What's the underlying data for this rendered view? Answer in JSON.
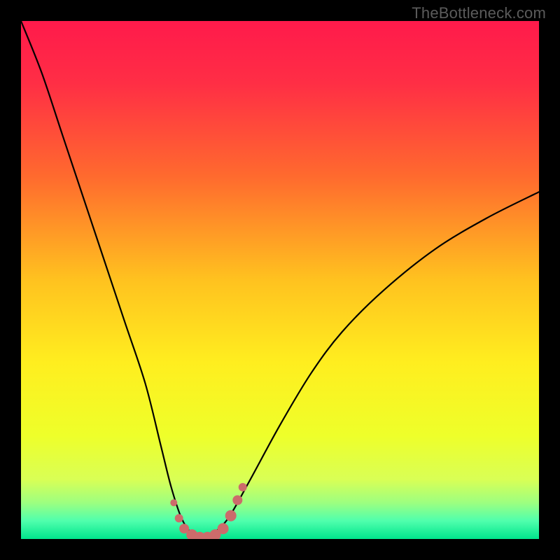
{
  "watermark": "TheBottleneck.com",
  "colors": {
    "frame": "#000000",
    "gradient_stops": [
      {
        "offset": 0.0,
        "color": "#ff1a4b"
      },
      {
        "offset": 0.12,
        "color": "#ff2e45"
      },
      {
        "offset": 0.3,
        "color": "#ff6a2e"
      },
      {
        "offset": 0.5,
        "color": "#ffc21f"
      },
      {
        "offset": 0.66,
        "color": "#ffee1f"
      },
      {
        "offset": 0.8,
        "color": "#eeff2a"
      },
      {
        "offset": 0.885,
        "color": "#d9ff55"
      },
      {
        "offset": 0.93,
        "color": "#9dff80"
      },
      {
        "offset": 0.965,
        "color": "#4fffad"
      },
      {
        "offset": 1.0,
        "color": "#00e58c"
      }
    ],
    "curve": "#000000",
    "marker": "#cc6b6b"
  },
  "chart_data": {
    "type": "line",
    "title": "",
    "xlabel": "",
    "ylabel": "",
    "xlim": [
      0,
      100
    ],
    "ylim": [
      0,
      100
    ],
    "series": [
      {
        "name": "bottleneck-curve",
        "x": [
          0,
          4,
          8,
          12,
          16,
          20,
          24,
          27,
          29,
          31,
          33,
          35,
          37,
          40,
          44,
          50,
          56,
          62,
          70,
          80,
          90,
          100
        ],
        "y": [
          100,
          90,
          78,
          66,
          54,
          42,
          30,
          18,
          10,
          4,
          1,
          0,
          1,
          4,
          11,
          22,
          32,
          40,
          48,
          56,
          62,
          67
        ]
      }
    ],
    "markers": {
      "name": "bottom-cluster",
      "points": [
        {
          "x": 29.5,
          "y": 7.0,
          "r": 5
        },
        {
          "x": 30.5,
          "y": 4.0,
          "r": 6
        },
        {
          "x": 31.5,
          "y": 2.0,
          "r": 7
        },
        {
          "x": 33.0,
          "y": 0.8,
          "r": 8
        },
        {
          "x": 34.5,
          "y": 0.3,
          "r": 8
        },
        {
          "x": 36.0,
          "y": 0.3,
          "r": 8
        },
        {
          "x": 37.5,
          "y": 0.8,
          "r": 8
        },
        {
          "x": 39.0,
          "y": 2.0,
          "r": 8
        },
        {
          "x": 40.5,
          "y": 4.5,
          "r": 8
        },
        {
          "x": 41.8,
          "y": 7.5,
          "r": 7
        },
        {
          "x": 42.8,
          "y": 10.0,
          "r": 6
        }
      ]
    }
  }
}
